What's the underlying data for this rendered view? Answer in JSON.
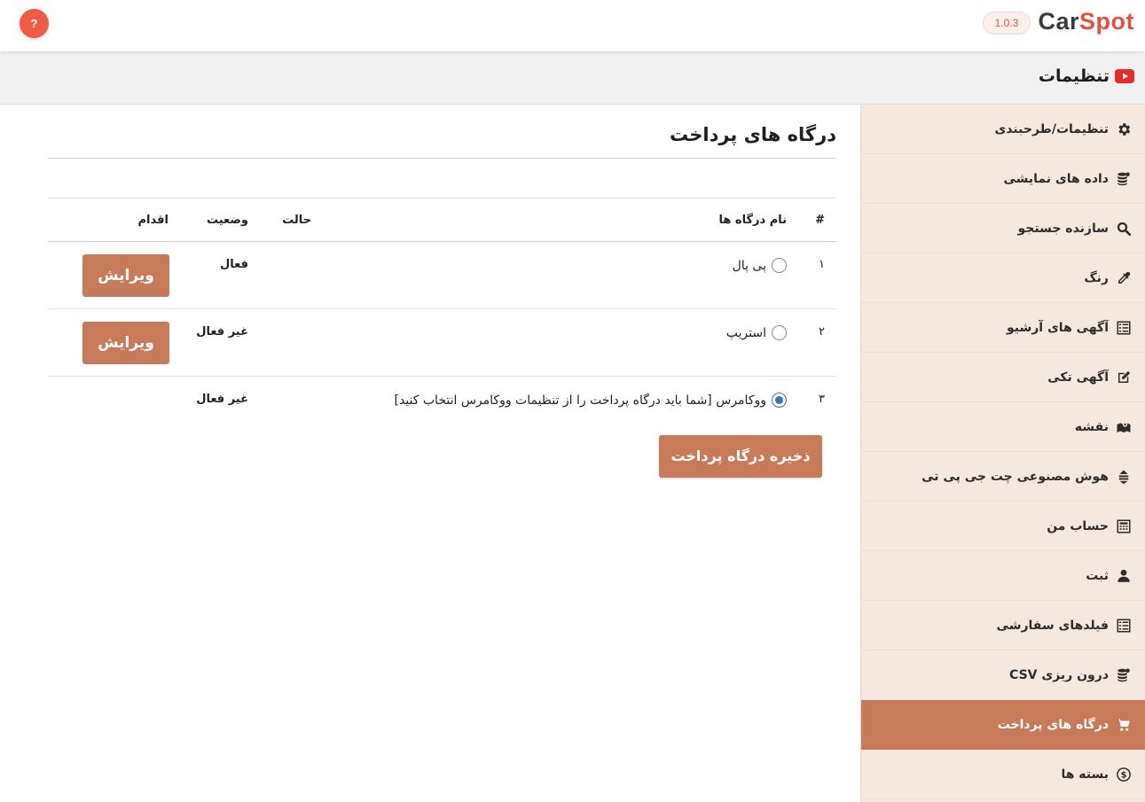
{
  "topbar": {
    "brand_part1": "Car",
    "brand_part2": "Spot",
    "version": "1.0.3",
    "help_label": "?"
  },
  "settings": {
    "title": "تنظیمات"
  },
  "sidebar": {
    "items": [
      {
        "label": "تنظیمات/طرحبندی",
        "icon": "gear-icon"
      },
      {
        "label": "داده های نمایشی",
        "icon": "coins-database-icon"
      },
      {
        "label": "سازنده جستجو",
        "icon": "search-icon"
      },
      {
        "label": "رنگ",
        "icon": "eyedropper-icon"
      },
      {
        "label": "آگهی های آرشیو",
        "icon": "list-icon"
      },
      {
        "label": "آگهی تکی",
        "icon": "edit-icon"
      },
      {
        "label": "نقشه",
        "icon": "map-icon"
      },
      {
        "label": "هوش مصنوعی چت جی پی تی",
        "icon": "ai-icon"
      },
      {
        "label": "حساب من",
        "icon": "calculator-icon"
      },
      {
        "label": "ثبت",
        "icon": "user-icon"
      },
      {
        "label": "فیلدهای سفارشی",
        "icon": "list-icon"
      },
      {
        "label": "درون ریزی CSV",
        "icon": "coins-database-icon"
      },
      {
        "label": "درگاه های پرداخت",
        "icon": "cart-icon",
        "active": true
      },
      {
        "label": "بسته ها",
        "icon": "dollar-circle-icon"
      }
    ]
  },
  "main": {
    "title": "درگاه های پرداخت",
    "table": {
      "headers": {
        "num": "#",
        "name": "نام درگاه ها",
        "mode": "حالت",
        "status": "وضعیت",
        "action": "اقدام"
      },
      "rows": [
        {
          "num": "۱",
          "name": "پی پال",
          "status": "فعال",
          "checked": false,
          "action": "ویرایش"
        },
        {
          "num": "۲",
          "name": "استریپ",
          "status": "غیر فعال",
          "checked": false,
          "action": "ویرایش"
        },
        {
          "num": "۳",
          "name": "ووکامرس [شما باید درگاه پرداخت را از تنظیمات ووکامرس انتخاب کنید]",
          "status": "غیر فعال",
          "checked": true,
          "action": ""
        }
      ]
    },
    "save_label": "ذخیره درگاه پرداخت"
  },
  "colors": {
    "accent": "#c77b58",
    "sidebar_bg": "#f5e8df",
    "brand_red": "#e2533c"
  }
}
